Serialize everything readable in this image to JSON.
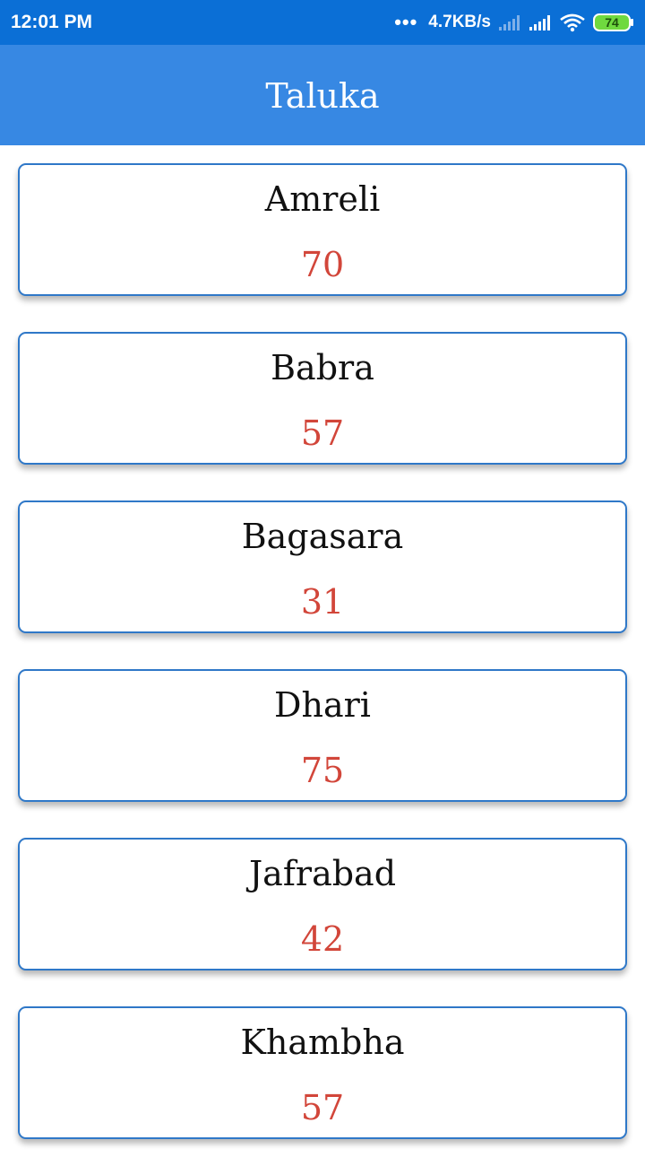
{
  "status_bar": {
    "time": "12:01 PM",
    "dots": "•••",
    "net_speed": "4.7KB/s",
    "battery_level": "74",
    "icons": [
      "signal-weak-icon",
      "signal-icon",
      "wifi-icon",
      "battery-icon"
    ]
  },
  "app_bar": {
    "title": "Taluka",
    "color": "#3788e3"
  },
  "colors": {
    "status_bar": "#0b6fd6",
    "card_border": "#2f78c8",
    "count_text": "#d2463a"
  },
  "talukas": [
    {
      "name": "Amreli",
      "count": "70"
    },
    {
      "name": "Babra",
      "count": "57"
    },
    {
      "name": "Bagasara",
      "count": "31"
    },
    {
      "name": "Dhari",
      "count": "75"
    },
    {
      "name": "Jafrabad",
      "count": "42"
    },
    {
      "name": "Khambha",
      "count": "57"
    }
  ]
}
